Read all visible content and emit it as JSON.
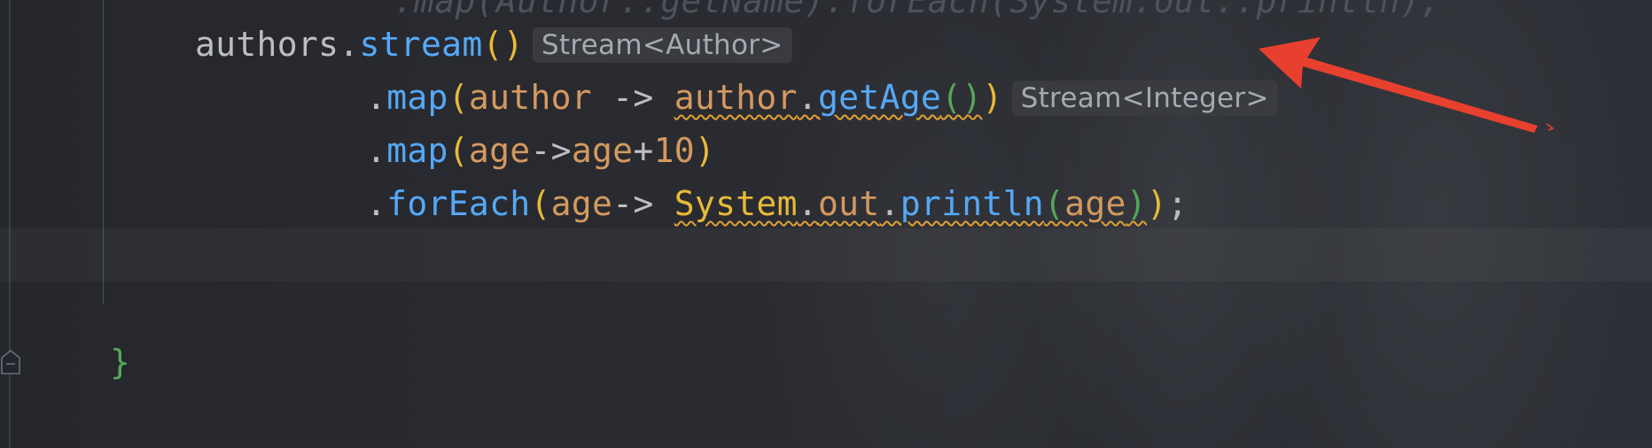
{
  "editor": {
    "lines": {
      "faded_top": ".map(Author::getName).forEach(System.out::println);",
      "line1": {
        "receiver": "authors",
        "dot": ".",
        "method": "stream",
        "paren_open": "(",
        "paren_close": ")",
        "hint": "Stream<Author>"
      },
      "line2": {
        "dot": ".",
        "method": "map",
        "paren_open": "(",
        "param": "author",
        "arrow": " -> ",
        "target": "author",
        "dot2": ".",
        "call": "getAge",
        "inner_paren": "()",
        "paren_close": ")",
        "hint": "Stream<Integer>"
      },
      "line3": {
        "dot": ".",
        "method": "map",
        "paren_open": "(",
        "param": "age",
        "arrow": "->",
        "param2": "age",
        "plus": "+",
        "number": "10",
        "paren_close": ")"
      },
      "line4": {
        "dot": ".",
        "method": "forEach",
        "paren_open": "(",
        "param": "age",
        "arrow": "-> ",
        "cls": "System",
        "dot2": ".",
        "field": "out",
        "dot3": ".",
        "call": "println",
        "inner_open": "(",
        "arg": "age",
        "inner_close": ")",
        "paren_close": ")",
        "semicolon": ";"
      },
      "closing_brace": "}"
    }
  },
  "colors": {
    "annotation_arrow": "#e8402e",
    "method": "#56a8f5",
    "paren": "#e8ba36",
    "param": "#d4995f",
    "brace": "#54a857",
    "warning_squiggle": "#e2a133"
  },
  "icons": {
    "fold": "fold-marker-icon",
    "arrow": "red-annotation-arrow-icon"
  }
}
